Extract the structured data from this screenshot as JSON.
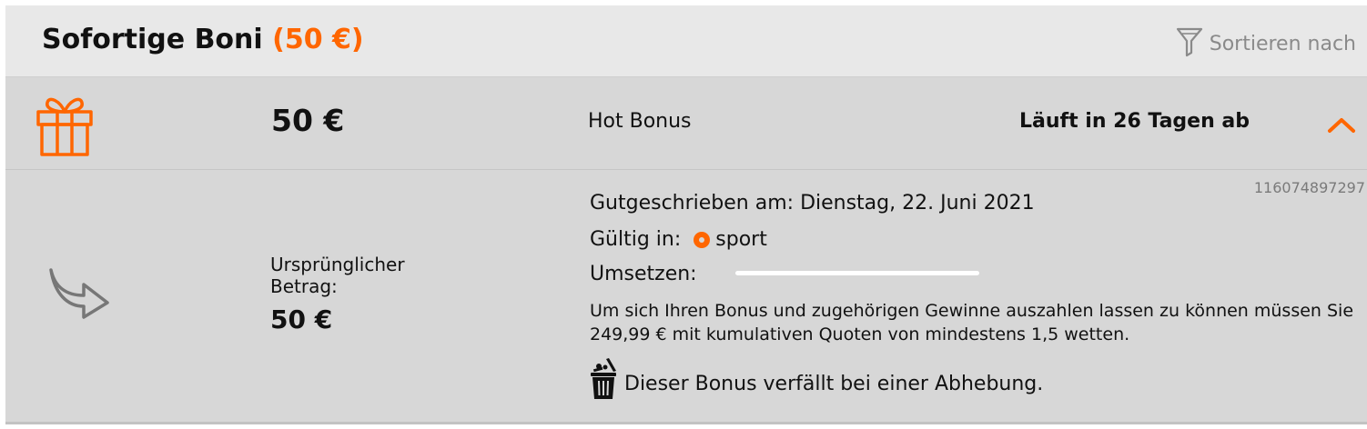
{
  "header": {
    "title": "Sofortige Boni",
    "total": "(50 €)",
    "sort_label": "Sortieren nach"
  },
  "bonus": {
    "amount": "50 €",
    "type": "Hot Bonus",
    "expiry": "Läuft in 26 Tagen ab",
    "id": "116074897297",
    "credited": "Gutgeschrieben am: Dienstag, 22. Juni 2021",
    "valid_label": "Gültig in:",
    "valid_value": "sport",
    "wager_label": "Umsetzen:",
    "wager_progress_percent": 0,
    "original_label": "Ursprünglicher Betrag:",
    "original_amount": "50 €",
    "conditions": "Um sich Ihren Bonus und zugehörigen Gewinne auszahlen lassen zu können müssen Sie 249,99 € mit kumulativen Quoten von mindestens 1,5 wetten.",
    "forfeit": "Dieser Bonus verfällt bei einer Abhebung."
  },
  "colors": {
    "accent": "#ff6600",
    "header_bg": "#e8e8e8",
    "row_bg": "#d7d7d7"
  },
  "icons": [
    "filter-icon",
    "gift-icon",
    "chevron-up-icon",
    "forward-arrow-icon",
    "trash-icon"
  ]
}
